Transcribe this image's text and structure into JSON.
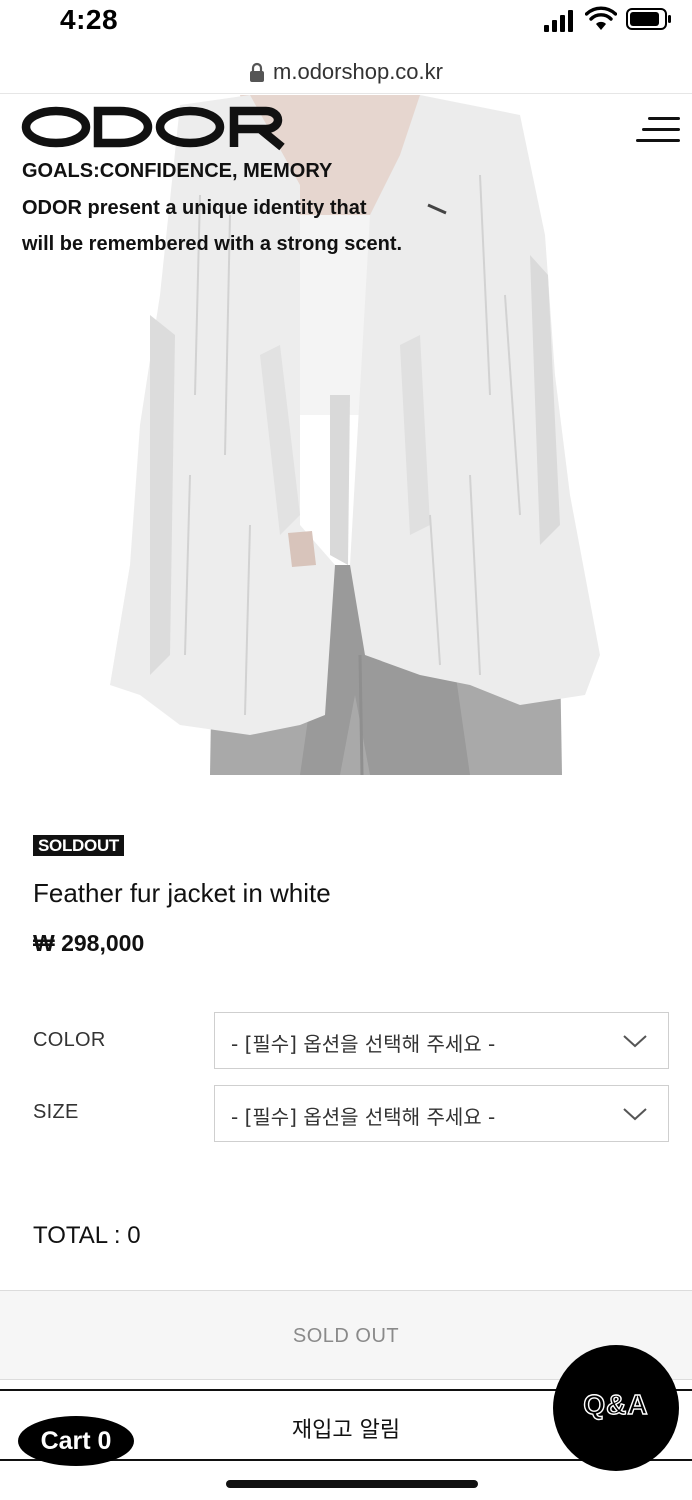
{
  "status_bar": {
    "time": "4:28",
    "icons": [
      "signal-icon",
      "wifi-icon",
      "battery-icon"
    ]
  },
  "browser": {
    "url": "m.odorshop.co.kr",
    "icons": [
      "lock-icon"
    ]
  },
  "header": {
    "brand": "ODOR",
    "menu_icon": "hamburger-menu-icon",
    "tagline": [
      "GOALS:CONFIDENCE, MEMORY",
      "ODOR present a unique identity that",
      "will be remembered with a strong scent."
    ]
  },
  "product": {
    "badge": "SOLDOUT",
    "name": "Feather fur jacket in white",
    "price": "₩ 298,000"
  },
  "options": [
    {
      "label": "COLOR",
      "value": "- [필수] 옵션을 선택해 주세요 -",
      "icon": "chevron-down-icon"
    },
    {
      "label": "SIZE",
      "value": "- [필수] 옵션을 선택해 주세요 -",
      "icon": "chevron-down-icon"
    }
  ],
  "total": "TOTAL : 0",
  "actions": {
    "soldout": "SOLD OUT",
    "restock": "재입고 알림",
    "cart": "Cart 0",
    "qa": "Q&A"
  },
  "colors": {
    "accent": "#111111",
    "badge_bg": "#111111",
    "soldout_bg": "#f6f6f6",
    "soldout_text": "#8a8a8a",
    "select_border": "#cfcfcf"
  }
}
